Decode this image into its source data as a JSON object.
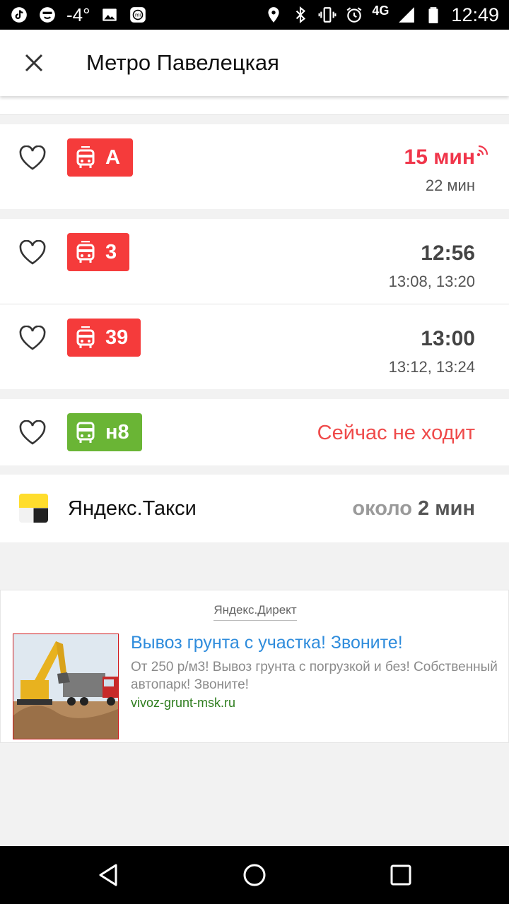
{
  "status_bar": {
    "temperature": "-4°",
    "network": "4G",
    "time": "12:49",
    "icons_left": [
      "tiktok-icon",
      "face-icon",
      "image-icon",
      "mi-icon"
    ],
    "icons_right": [
      "location-icon",
      "bluetooth-icon",
      "vibrate-icon",
      "alarm-icon",
      "signal-icon",
      "battery-icon"
    ]
  },
  "header": {
    "title": "Метро Павелецкая",
    "close_icon": "close-icon"
  },
  "routes": [
    {
      "number": "A",
      "type": "trolleybus",
      "color": "#f53b3b",
      "main": "15 мин",
      "sub": "22 мин",
      "live": true
    },
    {
      "number": "3",
      "type": "trolleybus",
      "color": "#f53b3b",
      "main": "12:56",
      "sub": "13:08, 13:20",
      "live": false
    },
    {
      "number": "39",
      "type": "trolleybus",
      "color": "#f53b3b",
      "main": "13:00",
      "sub": "13:12, 13:24",
      "live": false
    },
    {
      "number": "н8",
      "type": "bus",
      "color": "#6ab535",
      "status": "Сейчас не ходит"
    }
  ],
  "taxi": {
    "name": "Яндекс.Такси",
    "eta_prefix": "около",
    "eta_value": "2 мин"
  },
  "ad": {
    "label": "Яндекс.Директ",
    "title": "Вывоз грунта с участка! Звоните!",
    "text": "От 250 р/м3! Вывоз грунта с погрузкой и без! Собственный автопарк! Звоните!",
    "url": "vivoz-grunt-msk.ru"
  },
  "colors": {
    "accent_red": "#f0354a",
    "badge_red": "#f53b3b",
    "badge_green": "#6ab535",
    "link_blue": "#2f8cdc"
  }
}
